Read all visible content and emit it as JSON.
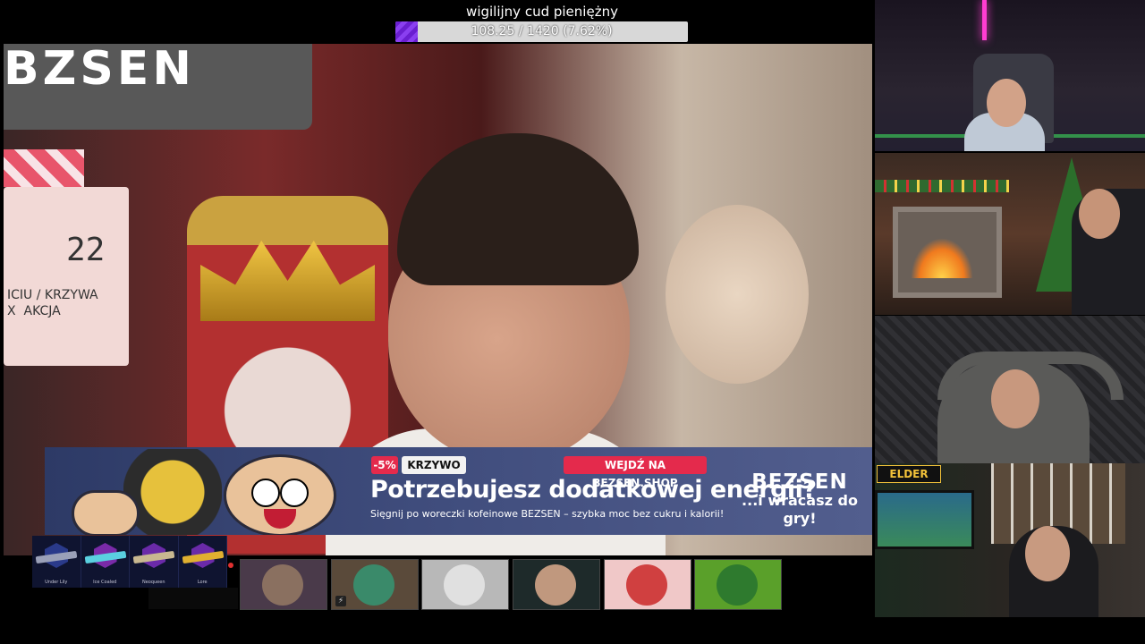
{
  "goal": {
    "title": "wigilijny cud pieniężny",
    "current": 108.25,
    "target": 1420,
    "progress_fraction": 0.0762,
    "progress_text": "108.25 / 1420 (7.62%)",
    "fill_color": "#7b2fe0"
  },
  "main_cam": {
    "wall_sign_text": "BZSEN",
    "clapper_number": "22",
    "clapper_text": "ICIU / KRZYWA\nX  AKCJA"
  },
  "ad": {
    "discount": "-5%",
    "code": "KRZYWO",
    "cta": "WEJDŹ NA BEZSEN.SHOP",
    "headline": "Potrzebujesz dodatkowej energii?",
    "subtext": "Sięgnij po woreczki kofeinowe BEZSEN – szybka moc bez cukru i kalorii!",
    "brand": "BEZSEN",
    "tagline": "...i wracasz do gry!"
  },
  "skins": [
    {
      "name": "Under Lily",
      "color": "#2a3a8a",
      "gun_color": "#9aa0b8"
    },
    {
      "name": "Ice Coaled",
      "color": "#7a2aa8",
      "gun_color": "#5ad0e0"
    },
    {
      "name": "Neoqueen",
      "color": "#6a2aa8",
      "gun_color": "#c8b890"
    },
    {
      "name": "Lore",
      "color": "#6a2aa8",
      "gun_color": "#e0b030"
    }
  ],
  "viewer_tiles": [
    {
      "id": "tile-1",
      "bg": "#4a3a4a",
      "avatar": "#8a7060",
      "icon": ""
    },
    {
      "id": "tile-2",
      "bg": "#5a4a3a",
      "avatar": "#3a8a6a",
      "icon": "⚡"
    },
    {
      "id": "tile-3",
      "bg": "#b8b8b8",
      "avatar": "#e0e0e0",
      "icon": ""
    },
    {
      "id": "tile-4",
      "bg": "#1e2a2a",
      "avatar": "#c0987e",
      "icon": ""
    },
    {
      "id": "tile-5",
      "bg": "#f0c8c8",
      "avatar": "#d04040",
      "icon": ""
    },
    {
      "id": "tile-6",
      "bg": "#5aa02a",
      "avatar": "#2e7a2e",
      "icon": ""
    }
  ],
  "side_cams": {
    "cam4_logo": "ELDER"
  }
}
